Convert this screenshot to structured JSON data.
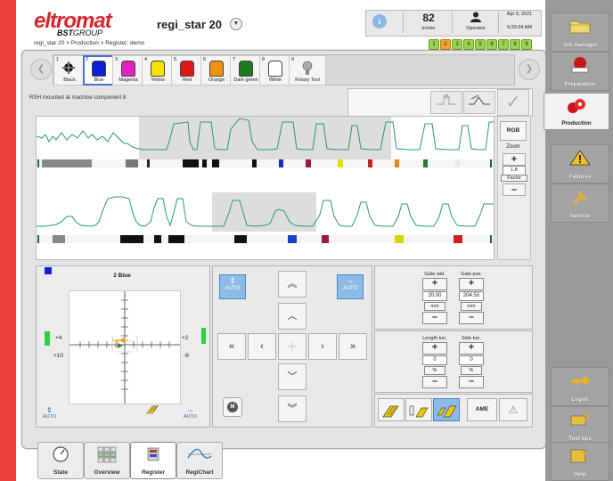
{
  "header": {
    "logo_text": "eltromat",
    "logo_sub_a": "BST",
    "logo_sub_b": "GROUP",
    "machine_name": "regi_star 20",
    "breadcrumb": "regi_star 20 > Production > Register: demo",
    "speed_value": "82",
    "speed_unit": "m/min",
    "operator_label": "Operator",
    "date": "Apr 9, 2021",
    "time": "9:20:34 AM",
    "info_glyph": "i",
    "unit_badges": [
      "1",
      "2",
      "3",
      "4",
      "5",
      "6",
      "7",
      "8",
      "9"
    ]
  },
  "colors": [
    {
      "num": "1",
      "label": "Black",
      "swatch": "register-mark-icon"
    },
    {
      "num": "2",
      "label": "Blue",
      "color": "#1020d8"
    },
    {
      "num": "3",
      "label": "Magenta",
      "color": "#e020c0"
    },
    {
      "num": "4",
      "label": "Yellow",
      "color": "#f4e400"
    },
    {
      "num": "5",
      "label": "Red",
      "color": "#e01818"
    },
    {
      "num": "6",
      "label": "Orange",
      "color": "#f09010"
    },
    {
      "num": "7",
      "label": "Dark green",
      "color": "#1c7a20"
    },
    {
      "num": "8",
      "label": "White",
      "color": "#ffffff"
    },
    {
      "num": "9",
      "label": "Rotary Tool",
      "swatch": "rotary-tool-icon"
    }
  ],
  "mount_info": "RSH mounted at machine component 8",
  "side": {
    "rgb_label": "RGB",
    "zoom_label": "Zoom",
    "factor_value": "1.8",
    "factor_label": "Factor",
    "plus": "+",
    "minus": "–"
  },
  "position": {
    "title": "2 Blue",
    "left_top_value": "+4",
    "left_bottom_value": "+10",
    "right_top_value": "+2",
    "right_bottom_value": "-9",
    "auto_label": "AUTO"
  },
  "controls": {
    "auto_label": "AUTO",
    "m_label": "M"
  },
  "gate": {
    "width_label": "Gate wid.",
    "width_value": "20.00",
    "width_unit": "mm",
    "pos_label": "Gate pos.",
    "pos_value": "204.50",
    "pos_unit": "mm"
  },
  "tuning": {
    "length_label": "Length tun.",
    "length_value": "0",
    "length_unit": "%",
    "side_label": "Side tun.",
    "side_value": "0",
    "side_unit": "%"
  },
  "mode": {
    "ame_label": "AME"
  },
  "right_nav": [
    {
      "label": "Job manager",
      "icon": "folder-icon"
    },
    {
      "label": "Preparation",
      "icon": "preparation-icon"
    },
    {
      "label": "Production",
      "icon": "production-icon"
    },
    {
      "label": "Failures",
      "icon": "failures-icon"
    },
    {
      "label": "Service",
      "icon": "service-icon"
    },
    {
      "label": "Log-in",
      "icon": "key-icon"
    },
    {
      "label": "Tool tips",
      "icon": "tooltips-icon"
    },
    {
      "label": "Help",
      "icon": "help-icon"
    }
  ],
  "bottom_tabs": [
    {
      "label": "State"
    },
    {
      "label": "Overview"
    },
    {
      "label": "Register"
    },
    {
      "label": "RegiChart"
    }
  ],
  "accent_colors": {
    "red": "#e8403a",
    "green_line": "#2a9a6a",
    "auto_blue": "#8cbbe8",
    "badge_green": "#9bd34f"
  }
}
